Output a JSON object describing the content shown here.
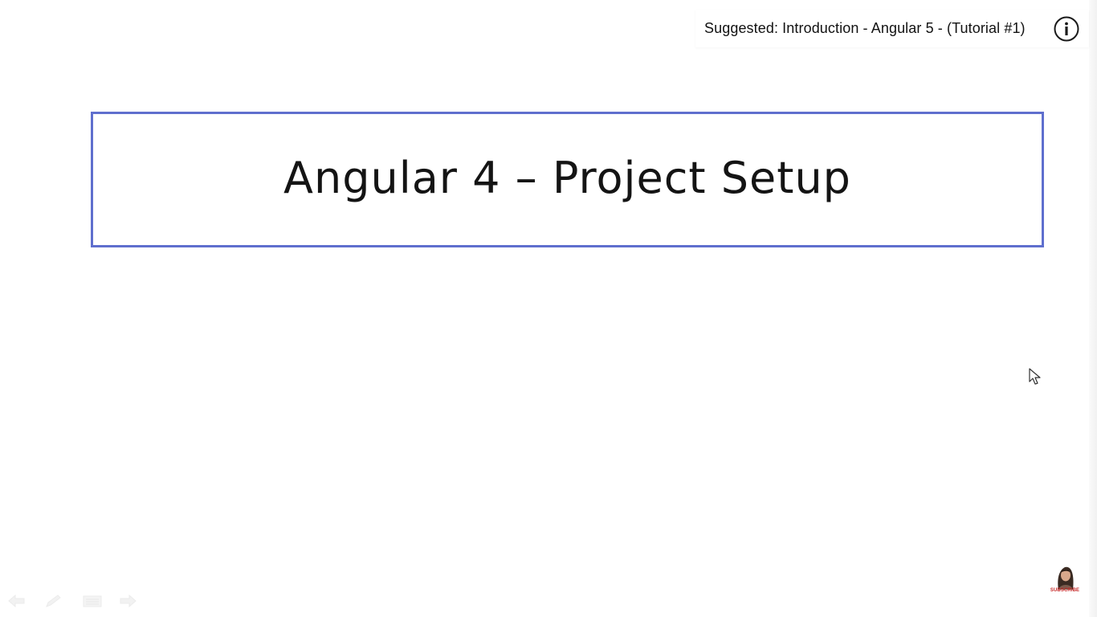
{
  "suggestion": {
    "text": "Suggested: Introduction - Angular 5 - (Tutorial #1)",
    "info_icon": "info-circle-icon"
  },
  "slide": {
    "title": "Angular 4 – Project Setup",
    "border_color": "#5f6fce"
  },
  "slide_nav": {
    "icons": [
      "previous-arrow-icon",
      "pen-icon",
      "menu-icon",
      "next-arrow-icon"
    ]
  },
  "subscribe": {
    "label": "SUBSCRIBE",
    "accent_color": "#c62828"
  },
  "pointer": {
    "icon": "mouse-cursor-icon"
  }
}
